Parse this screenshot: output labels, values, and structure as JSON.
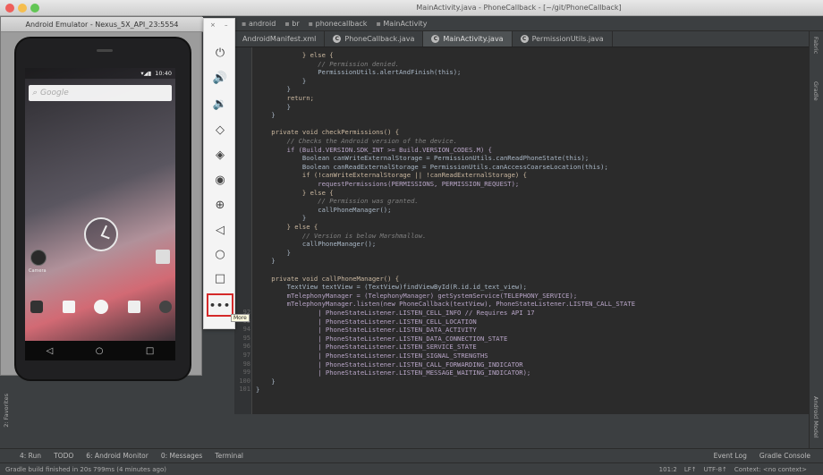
{
  "mac_title": "MainActivity.java - PhoneCallback - [~/git/PhoneCallback]",
  "breadcrumbs": [
    "android",
    "br",
    "phonecallback",
    "MainActivity"
  ],
  "tabs": [
    {
      "label": "AndroidManifest.xml",
      "icon": "c",
      "active": false
    },
    {
      "label": "PhoneCallback.java",
      "icon": "C",
      "active": false
    },
    {
      "label": "MainActivity.java",
      "icon": "C",
      "active": true
    },
    {
      "label": "PermissionUtils.java",
      "icon": "C",
      "active": false
    }
  ],
  "line_numbers": [
    "92",
    "93",
    "94",
    "95",
    "96",
    "97",
    "98",
    "99",
    "100",
    "101"
  ],
  "code_lines": [
    "            } else {",
    "                // Permission denied.",
    "                PermissionUtils.alertAndFinish(this);",
    "            }",
    "        }",
    "        return;",
    "        }",
    "    }",
    "",
    "    private void checkPermissions() {",
    "        // Checks the Android version of the device.",
    "        if (Build.VERSION.SDK_INT >= Build.VERSION_CODES.M) {",
    "            Boolean canWriteExternalStorage = PermissionUtils.canReadPhoneState(this);",
    "            Boolean canReadExternalStorage = PermissionUtils.canAccessCoarseLocation(this);",
    "            if (!canWriteExternalStorage || !canReadExternalStorage) {",
    "                requestPermissions(PERMISSIONS, PERMISSION_REQUEST);",
    "            } else {",
    "                // Permission was granted.",
    "                callPhoneManager();",
    "            }",
    "        } else {",
    "            // Version is below Marshmallow.",
    "            callPhoneManager();",
    "        }",
    "    }",
    "",
    "    private void callPhoneManager() {",
    "        TextView textView = (TextView)findViewById(R.id.id_text_view);",
    "        mTelephonyManager = (TelephonyManager) getSystemService(TELEPHONY_SERVICE);",
    "        mTelephonyManager.listen(new PhoneCallback(textView), PhoneStateListener.LISTEN_CALL_STATE",
    "                | PhoneStateListener.LISTEN_CELL_INFO // Requires API 17",
    "                | PhoneStateListener.LISTEN_CELL_LOCATION",
    "                | PhoneStateListener.LISTEN_DATA_ACTIVITY",
    "                | PhoneStateListener.LISTEN_DATA_CONNECTION_STATE",
    "                | PhoneStateListener.LISTEN_SERVICE_STATE",
    "                | PhoneStateListener.LISTEN_SIGNAL_STRENGTHS",
    "                | PhoneStateListener.LISTEN_CALL_FORWARDING_INDICATOR",
    "                | PhoneStateListener.LISTEN_MESSAGE_WAITING_INDICATOR);",
    "    }",
    "}"
  ],
  "right_strip": [
    "Fabric",
    "Gradle",
    "Android Model"
  ],
  "left_strip": [
    "2: Favorites"
  ],
  "tool_windows": [
    "4: Run",
    "TODO",
    "6: Android Monitor",
    "0: Messages",
    "Terminal"
  ],
  "tool_windows_right": [
    "Event Log",
    "Gradle Console"
  ],
  "status": {
    "message": "Gradle build finished in 20s 799ms (4 minutes ago)",
    "position": "101:2",
    "line_sep": "LF↑",
    "encoding": "UTF-8↑",
    "context": "Context: <no context>"
  },
  "emulator": {
    "title": "Android Emulator - Nexus_5X_API_23:5554",
    "clock": "10:40",
    "search_text": "Google",
    "camera_label": "Camera",
    "more_tooltip": "More"
  },
  "toolbar_icons": [
    "power-icon",
    "volume-up-icon",
    "volume-down-icon",
    "rotate-left-icon",
    "rotate-right-icon",
    "camera-icon",
    "zoom-icon",
    "back-icon",
    "home-icon",
    "overview-icon",
    "more-icon"
  ]
}
